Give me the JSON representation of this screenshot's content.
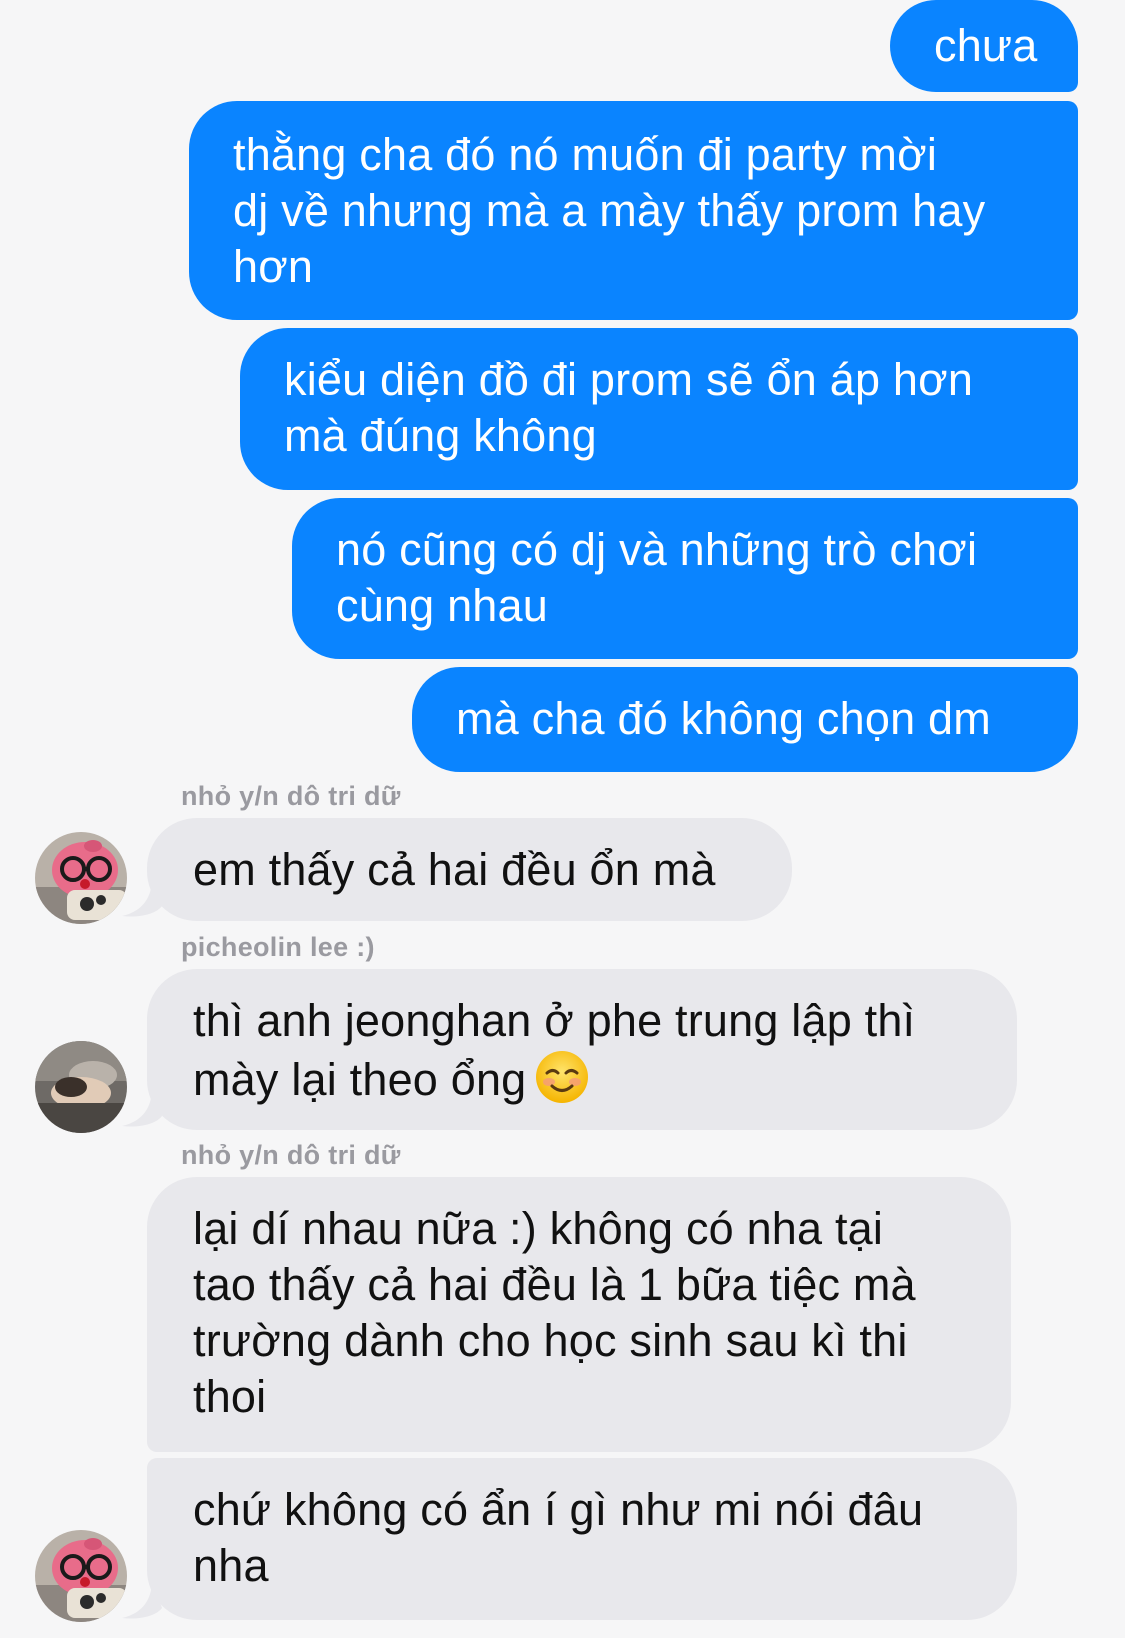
{
  "thread": {
    "messages_out": [
      {
        "text": "chưa"
      },
      {
        "text": "thằng cha đó nó muốn đi party mời\ndj về nhưng mà a mày thấy prom hay\nhơn"
      },
      {
        "text": "kiểu diện đồ đi prom sẽ ổn áp hơn\nmà đúng không"
      },
      {
        "text": "nó cũng có dj và những trò chơi\ncùng nhau"
      },
      {
        "text": "mà cha đó không chọn dm"
      }
    ],
    "messages_in": [
      {
        "sender": "nhỏ y/n dô tri dữ",
        "text": "em thấy cả hai đều ổn mà",
        "avatar": "pink-plush-glasses-avatar"
      },
      {
        "sender": "picheolin lee :)",
        "text": "thì anh jeonghan ở phe trung lập thì\nmày lại theo ổng",
        "emoji": "smiling-blush-emoji",
        "avatar": "sleeping-person-avatar"
      },
      {
        "sender": "nhỏ y/n dô tri dữ",
        "text": "lại dí nhau nữa :) không có nha tại\ntao thấy cả hai đều là 1 bữa tiệc mà\ntrường dành cho học sinh sau kì thi\nthoi"
      },
      {
        "text": "chứ không có ẩn í gì như mi nói đâu\nnha",
        "avatar": "pink-plush-glasses-avatar"
      }
    ]
  },
  "colors": {
    "outgoing_bubble": "#0a84ff",
    "incoming_bubble": "#e8e8ec",
    "background": "#f6f6f7",
    "sender_name": "#9a9aa0"
  }
}
